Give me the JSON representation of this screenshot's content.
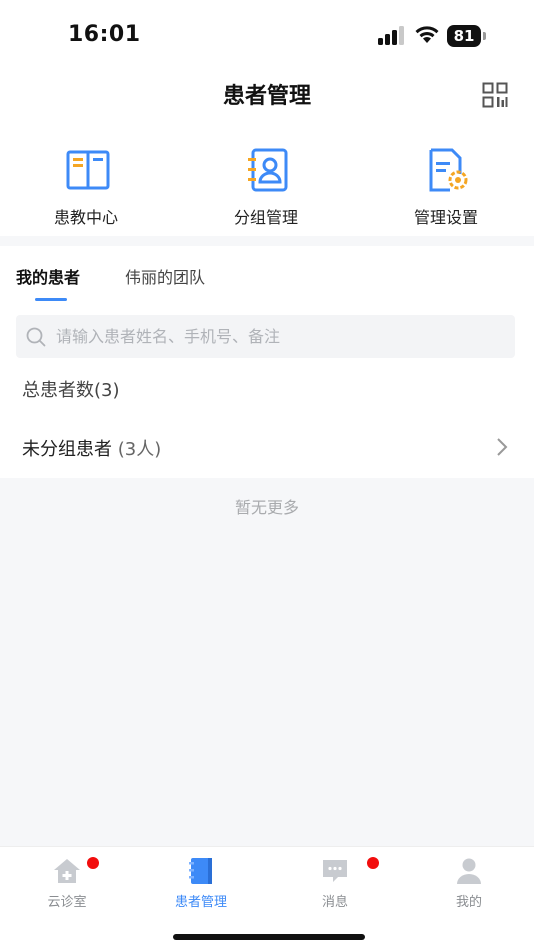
{
  "status_bar": {
    "time": "16:01",
    "battery": "81"
  },
  "header": {
    "title": "患者管理"
  },
  "quick_actions": [
    {
      "label": "患教中心",
      "icon": "book-open-icon"
    },
    {
      "label": "分组管理",
      "icon": "contact-card-icon"
    },
    {
      "label": "管理设置",
      "icon": "document-gear-icon"
    }
  ],
  "tabs": [
    {
      "label": "我的患者",
      "active": true
    },
    {
      "label": "伟丽的团队",
      "active": false
    }
  ],
  "search": {
    "placeholder": "请输入患者姓名、手机号、备注",
    "value": ""
  },
  "summary": {
    "total_label": "总患者数(3)"
  },
  "groups": [
    {
      "name": "未分组患者",
      "count_label": "(3人)"
    }
  ],
  "list_footer": "暂无更多",
  "tab_bar": [
    {
      "label": "云诊室",
      "icon": "home-plus-icon",
      "active": false,
      "badge": true
    },
    {
      "label": "患者管理",
      "icon": "patient-notebook-icon",
      "active": true,
      "badge": false
    },
    {
      "label": "消息",
      "icon": "chat-bubble-icon",
      "active": false,
      "badge": true
    },
    {
      "label": "我的",
      "icon": "user-icon",
      "active": false,
      "badge": false
    }
  ],
  "colors": {
    "accent": "#3d8af7",
    "orange": "#f5a623",
    "badge": "#f20d0d",
    "inactive": "#c8cbd0"
  }
}
